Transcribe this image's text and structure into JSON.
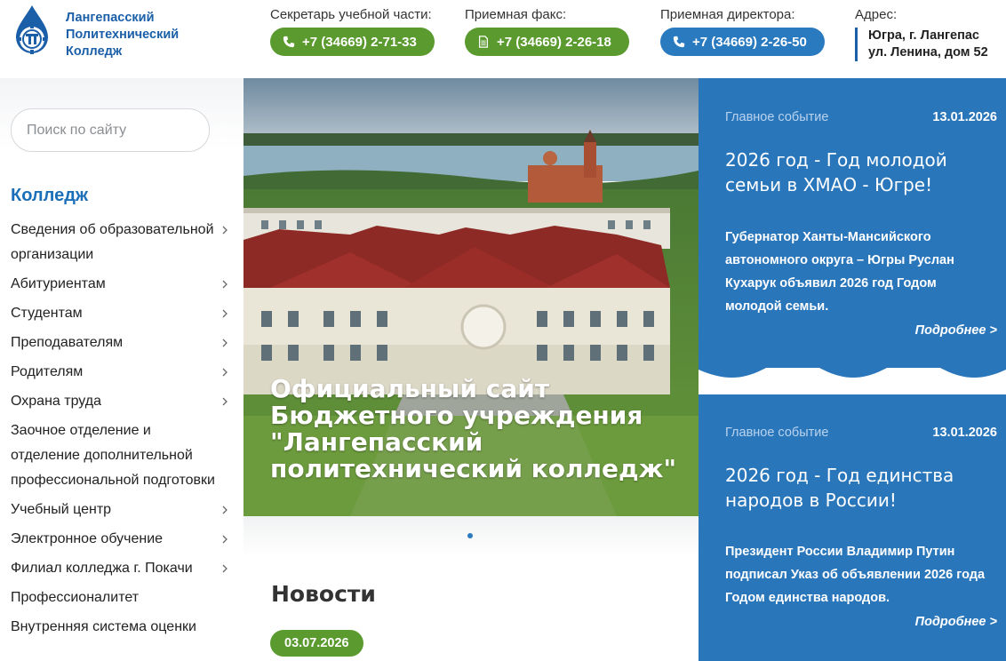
{
  "header": {
    "logo_text": [
      "Лангепасский",
      "Политехнический",
      "Колледж"
    ],
    "contacts": [
      {
        "label": "Секретарь учебной части:",
        "phone": "+7 (34669) 2-71-33",
        "icon": "phone-icon",
        "color": "#5a9a2e"
      },
      {
        "label": "Приемная факс:",
        "phone": "+7 (34669) 2-26-18",
        "icon": "fax-icon",
        "color": "#5a9a2e"
      },
      {
        "label": "Приемная директора:",
        "phone": "+7 (34669) 2-26-50",
        "icon": "phone-icon",
        "color": "#2a7ac0"
      }
    ],
    "address_label": "Адрес:",
    "address_lines": [
      "Югра, г. Лангепас",
      "ул. Ленина, дом 52"
    ]
  },
  "sidebar": {
    "search_placeholder": "Поиск по сайту",
    "menu_title": "Колледж",
    "items": [
      {
        "label": "Сведения об образовательной организации",
        "has_chevron": true
      },
      {
        "label": "Абитуриентам",
        "has_chevron": true
      },
      {
        "label": "Студентам",
        "has_chevron": true
      },
      {
        "label": "Преподавателям",
        "has_chevron": true
      },
      {
        "label": "Родителям",
        "has_chevron": true
      },
      {
        "label": "Охрана труда",
        "has_chevron": true
      },
      {
        "label": "Заочное отделение и отделение дополнительной профессиональной подготовки",
        "has_chevron": false
      },
      {
        "label": "Учебный центр",
        "has_chevron": true
      },
      {
        "label": "Электронное обучение",
        "has_chevron": true
      },
      {
        "label": "Филиал колледжа г. Покачи",
        "has_chevron": true
      },
      {
        "label": "Профессионалитет",
        "has_chevron": false
      },
      {
        "label": "Внутренняя система оценки",
        "has_chevron": false
      }
    ]
  },
  "hero": {
    "title": "Официальный сайт Бюджетного учреждения \"Лангепасский политехнический колледж\""
  },
  "news": {
    "title": "Новости",
    "first_date": "03.07.2026"
  },
  "events": [
    {
      "kind": "Главное событие",
      "date": "13.01.2026",
      "title": "2026 год - Год молодой семьи в ХМАО - Югре!",
      "text": "Губернатор Ханты-Мансийского автономного округа – Югры Руслан Кухарук объявил 2026 год Годом молодой семьи.",
      "more": "Подробнее >"
    },
    {
      "kind": "Главное событие",
      "date": "13.01.2026",
      "title": "2026 год - Год единства народов в России!",
      "text": "Президент России Владимир Путин подписал Указ об объявлении 2026 года Годом единства народов.",
      "more": "Подробнее >"
    }
  ],
  "colors": {
    "brand_blue": "#1a5fa8",
    "accent_green": "#5a9a2e",
    "event_blue": "#2a76bb"
  }
}
